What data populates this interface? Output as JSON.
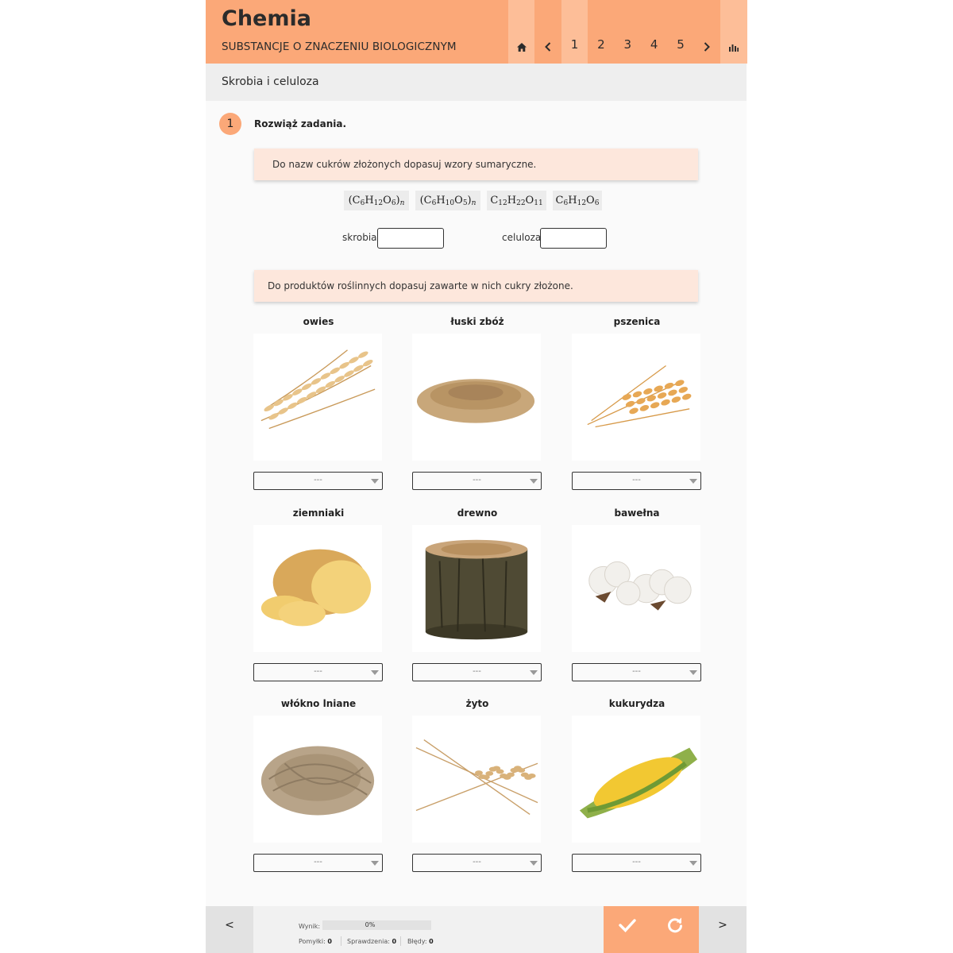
{
  "header": {
    "title": "Chemia",
    "subject": "SUBSTANCJE O ZNACZENIU BIOLOGICZNYM",
    "nav": {
      "home_icon": "home-icon",
      "prev_icon": "chevron-left-icon",
      "pages": [
        "1",
        "2",
        "3",
        "4",
        "5"
      ],
      "current_page": "1",
      "next_icon": "chevron-right-icon",
      "stats_icon": "bar-chart-icon"
    }
  },
  "section": {
    "title": "Skrobia i celuloza"
  },
  "task": {
    "number": "1",
    "instruction": "Rozwiąż zadania.",
    "part1": {
      "instruction": "Do nazw cukrów złożonych dopasuj wzory sumaryczne.",
      "formulas": [
        "(C6H12O6)n",
        "(C6H10O5)n",
        "C12H22O11",
        "C6H12O6"
      ],
      "fields": [
        {
          "label": "skrobia:",
          "value": ""
        },
        {
          "label": "celuloza:",
          "value": ""
        }
      ]
    },
    "part2": {
      "instruction": "Do produktów roślinnych dopasuj zawarte w nich cukry złożone.",
      "products": [
        {
          "label": "owies",
          "image": "oat-image",
          "selected": "---"
        },
        {
          "label": "łuski zbóż",
          "image": "grain-husks-image",
          "selected": "---"
        },
        {
          "label": "pszenica",
          "image": "wheat-image",
          "selected": "---"
        },
        {
          "label": "ziemniaki",
          "image": "potato-image",
          "selected": "---"
        },
        {
          "label": "drewno",
          "image": "wood-image",
          "selected": "---"
        },
        {
          "label": "bawełna",
          "image": "cotton-image",
          "selected": "---"
        },
        {
          "label": "włókno lniane",
          "image": "flax-fiber-image",
          "selected": "---"
        },
        {
          "label": "żyto",
          "image": "rye-image",
          "selected": "---"
        },
        {
          "label": "kukurydza",
          "image": "corn-image",
          "selected": "---"
        }
      ]
    }
  },
  "footer": {
    "prev": "<",
    "next": ">",
    "check_icon": "checkmark-icon",
    "reset_icon": "reset-icon",
    "score_label": "Wynik:",
    "score_value": "0%",
    "score_fraction": 0,
    "stats": [
      {
        "label": "Pomyłki:",
        "value": "0"
      },
      {
        "label": "Sprawdzenia:",
        "value": "0"
      },
      {
        "label": "Błędy:",
        "value": "0"
      }
    ]
  },
  "colors": {
    "accent": "#fba878",
    "accent_light": "#fdbe98",
    "instruction_bg": "#fde7dc",
    "section_bg": "#eeeeee",
    "footer_bg": "#f1f1f1"
  }
}
